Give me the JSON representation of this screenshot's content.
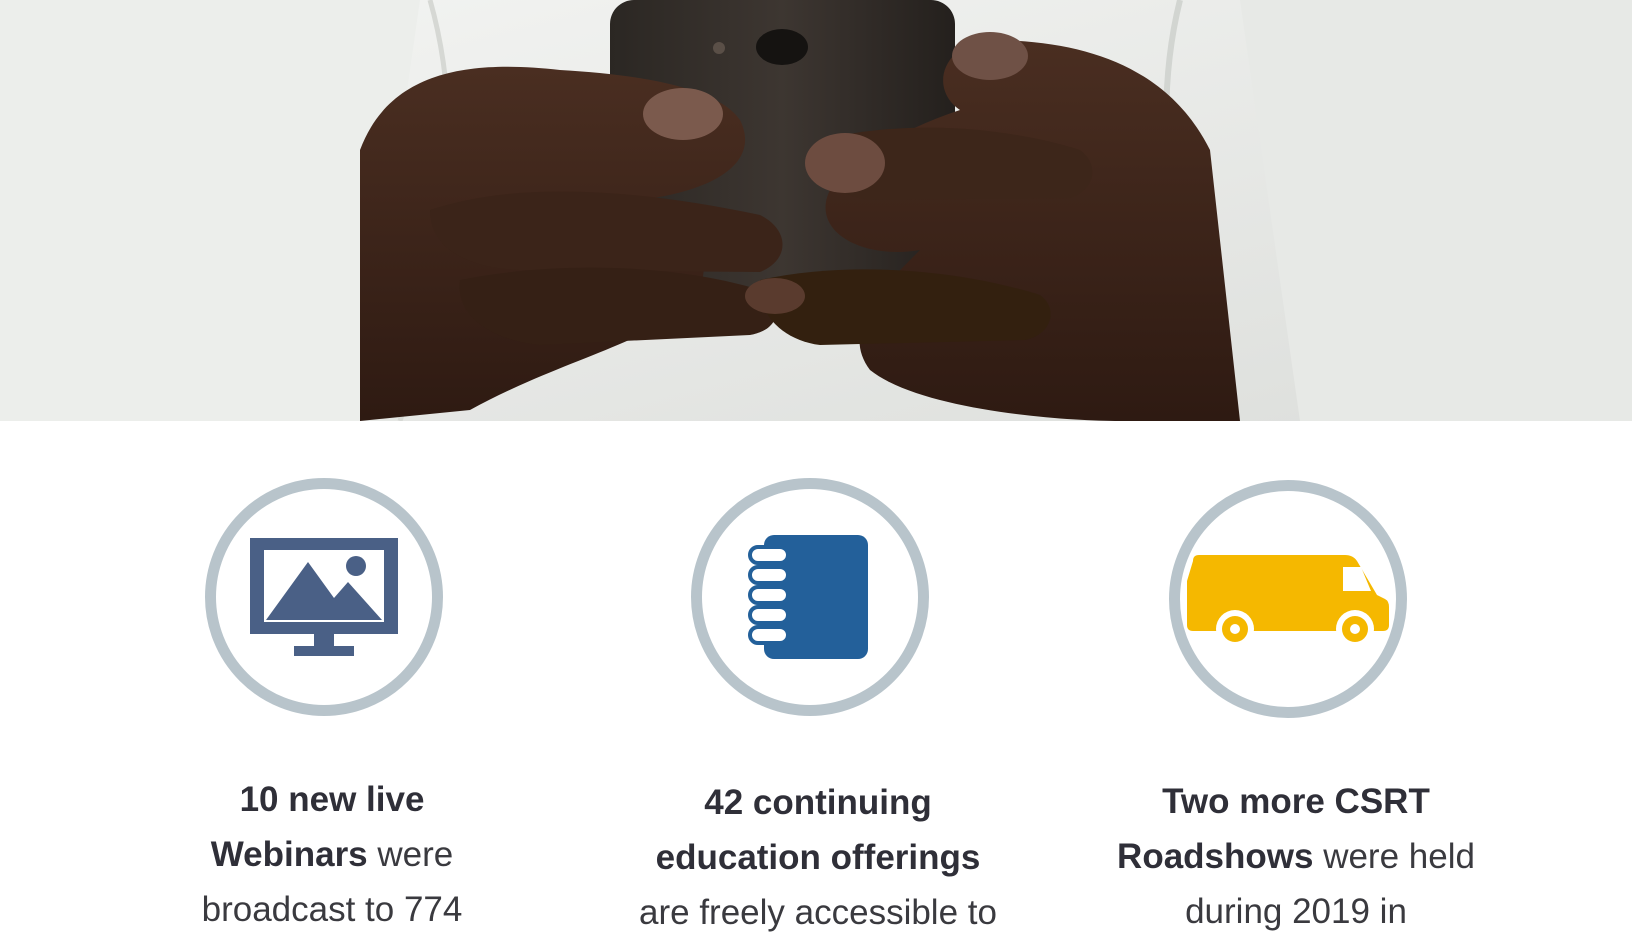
{
  "stats": [
    {
      "icon": "monitor-image-icon",
      "color": "#4a6086",
      "line1_bold": "10 new live",
      "line2_bold": "Webinars",
      "line2_rest": " were",
      "line3": "broadcast to 774"
    },
    {
      "icon": "notebook-icon",
      "color": "#23609a",
      "line1_bold": "42 continuing",
      "line2_bold": "education offerings",
      "line3": "are freely accessible to"
    },
    {
      "icon": "van-icon",
      "color": "#f5b800",
      "line1_bold": "Two more CSRT",
      "line2_bold": "Roadshows",
      "line2_rest": " were held",
      "line3": "during 2019 in"
    }
  ],
  "colors": {
    "ring": "#b8c4cb",
    "text": "#3a3a3f"
  }
}
